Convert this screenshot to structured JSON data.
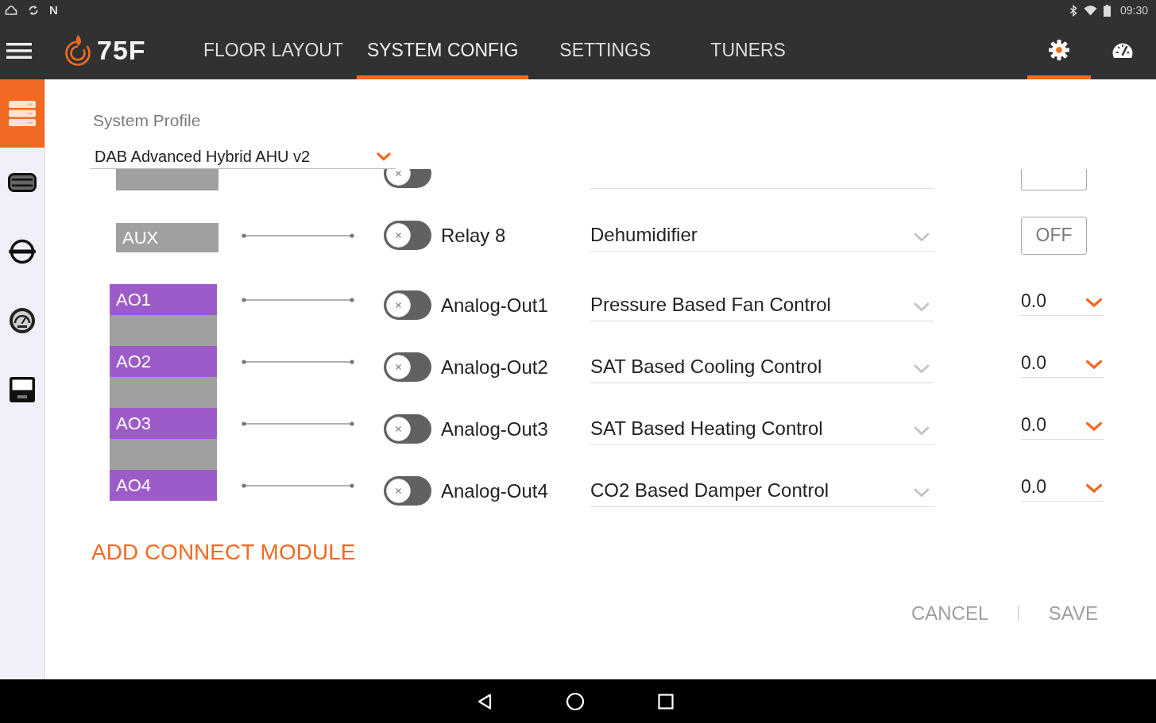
{
  "status_bar": {
    "notification_glyph": "N",
    "time": "09:30"
  },
  "app_bar": {
    "logo": "75F",
    "tabs": [
      {
        "label": "FLOOR LAYOUT",
        "selected": false
      },
      {
        "label": "SYSTEM CONFIG",
        "selected": true
      },
      {
        "label": "SETTINGS",
        "selected": false
      },
      {
        "label": "TUNERS",
        "selected": false
      }
    ],
    "icon_tabs": [
      {
        "kind": "settings",
        "selected": true
      },
      {
        "kind": "dashboard",
        "selected": false
      }
    ]
  },
  "sidebar": {
    "items": [
      {
        "kind": "system",
        "selected": true
      },
      {
        "kind": "module",
        "selected": false
      },
      {
        "kind": "equipment",
        "selected": false
      },
      {
        "kind": "gauge",
        "selected": false
      },
      {
        "kind": "meter",
        "selected": false
      }
    ]
  },
  "system_profile": {
    "label": "System Profile",
    "value": "DAB Advanced Hybrid AHU v2"
  },
  "cut_row": {
    "on": false
  },
  "rows": [
    {
      "kind": "relay",
      "port": "AUX",
      "on": false,
      "name": "Relay 8",
      "function": "Dehumidifier",
      "value": "OFF"
    },
    {
      "kind": "analog",
      "port": "AO1",
      "on": false,
      "name": "Analog-Out1",
      "function": "Pressure Based Fan Control",
      "value": "0.0"
    },
    {
      "kind": "analog",
      "port": "AO2",
      "on": false,
      "name": "Analog-Out2",
      "function": "SAT Based Cooling Control",
      "value": "0.0"
    },
    {
      "kind": "analog",
      "port": "AO3",
      "on": false,
      "name": "Analog-Out3",
      "function": "SAT Based Heating Control",
      "value": "0.0"
    },
    {
      "kind": "analog",
      "port": "AO4",
      "on": false,
      "name": "Analog-Out4",
      "function": "CO2 Based Damper Control",
      "value": "0.0"
    }
  ],
  "add_module": "ADD CONNECT MODULE",
  "actions": [
    "CANCEL",
    "SAVE"
  ]
}
